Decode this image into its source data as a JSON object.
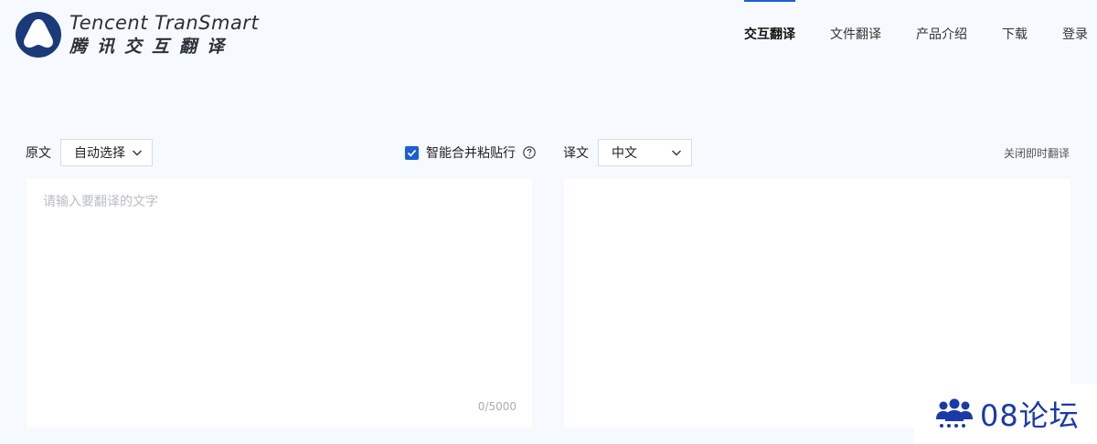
{
  "brand": {
    "name_en": "Tencent TranSmart",
    "name_cn": "腾讯交互翻译",
    "logo_icon": "transmart-logo-icon",
    "color": "#1a3a7a"
  },
  "nav": {
    "items": [
      {
        "label": "交互翻译",
        "active": true
      },
      {
        "label": "文件翻译",
        "active": false
      },
      {
        "label": "产品介绍",
        "active": false
      },
      {
        "label": "下载",
        "active": false
      },
      {
        "label": "登录",
        "active": false
      }
    ],
    "accent": "#1b5fd6"
  },
  "source": {
    "label": "原文",
    "language": "自动选择",
    "placeholder": "请输入要翻译的文字",
    "value": "",
    "counter": "0/5000"
  },
  "merge_option": {
    "label": "智能合并粘贴行",
    "checked": true
  },
  "target": {
    "label": "译文",
    "language": "中文",
    "close_realtime": "关闭即时翻译"
  },
  "watermark": {
    "text": "08论坛",
    "icon": "users-group-icon",
    "color": "#1a3aa8"
  }
}
